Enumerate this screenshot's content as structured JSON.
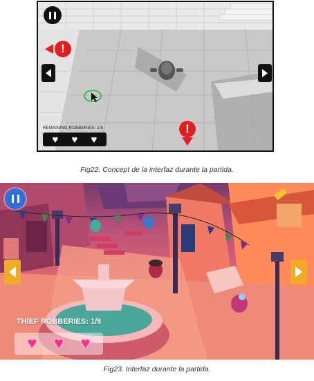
{
  "fig22": {
    "robberies_label": "REMAINING ROBBERIES: 1/5",
    "hearts": [
      "♥",
      "♥",
      "♥"
    ],
    "caption": "Fig22. Concept de la interfaz durante la partida.",
    "alert_glyph": "!",
    "icons": [
      "pause-icon",
      "arrow-left-icon",
      "arrow-right-icon",
      "alert-icon",
      "target-cursor-icon",
      "heart-icon"
    ]
  },
  "fig23": {
    "robberies_label": "THIEF ROBBERIES: 1/8",
    "hearts": [
      "♥",
      "♥",
      "♥"
    ],
    "caption": "Fig23. Interfaz durante la partida.",
    "colors": {
      "pause": "#2f6ee0",
      "arrows": "#f2a928",
      "hearts": "#ff2f8e"
    },
    "icons": [
      "pause-icon",
      "arrow-left-icon",
      "arrow-right-icon",
      "heart-icon"
    ]
  }
}
